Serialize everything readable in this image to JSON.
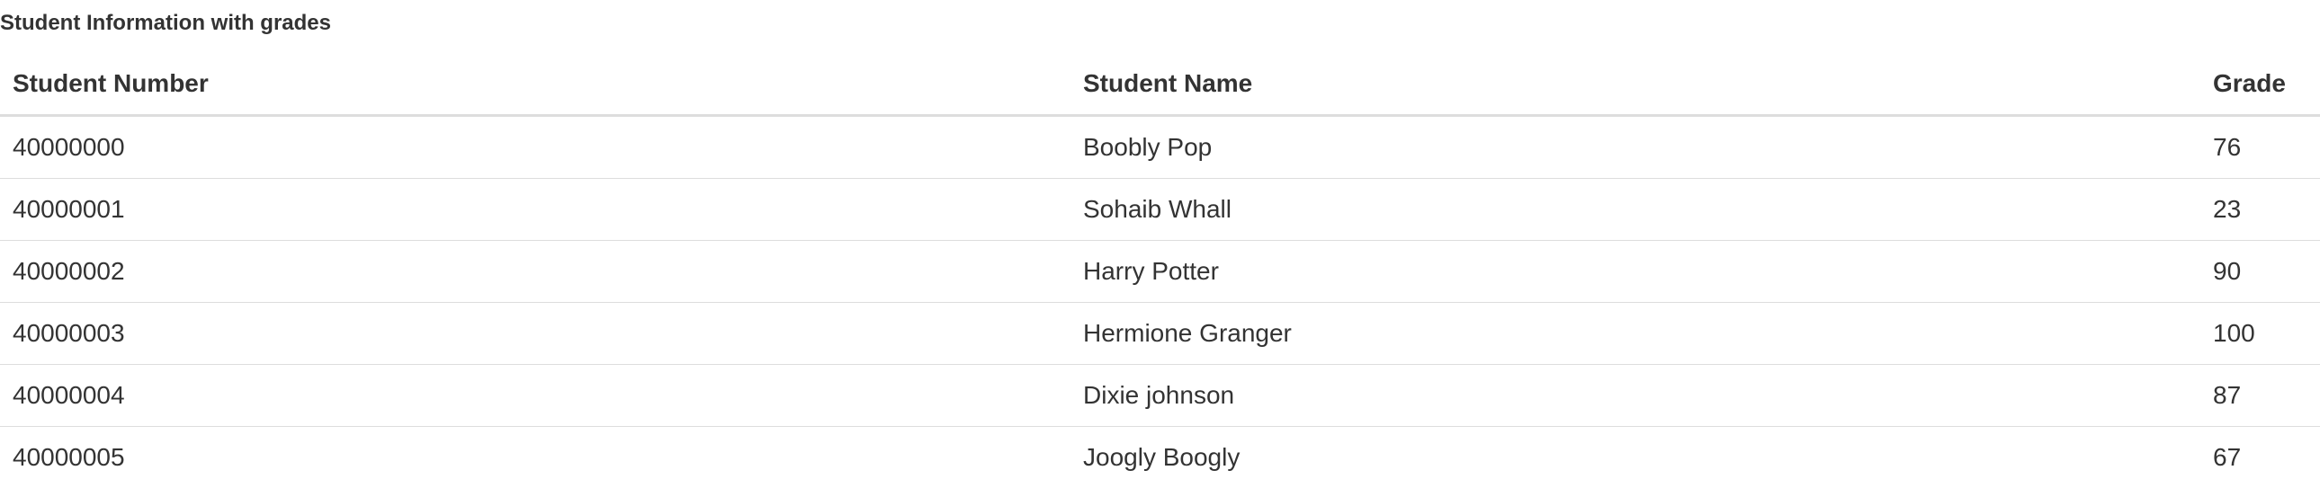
{
  "page": {
    "title": "Student Information with grades"
  },
  "table": {
    "headers": {
      "student_number": "Student Number",
      "student_name": "Student Name",
      "grade": "Grade"
    },
    "rows": [
      {
        "student_number": "40000000",
        "student_name": "Boobly Pop",
        "grade": "76"
      },
      {
        "student_number": "40000001",
        "student_name": "Sohaib Whall",
        "grade": "23"
      },
      {
        "student_number": "40000002",
        "student_name": "Harry Potter",
        "grade": "90"
      },
      {
        "student_number": "40000003",
        "student_name": "Hermione Granger",
        "grade": "100"
      },
      {
        "student_number": "40000004",
        "student_name": "Dixie johnson",
        "grade": "87"
      },
      {
        "student_number": "40000005",
        "student_name": "Joogly Boogly",
        "grade": "67"
      }
    ]
  }
}
